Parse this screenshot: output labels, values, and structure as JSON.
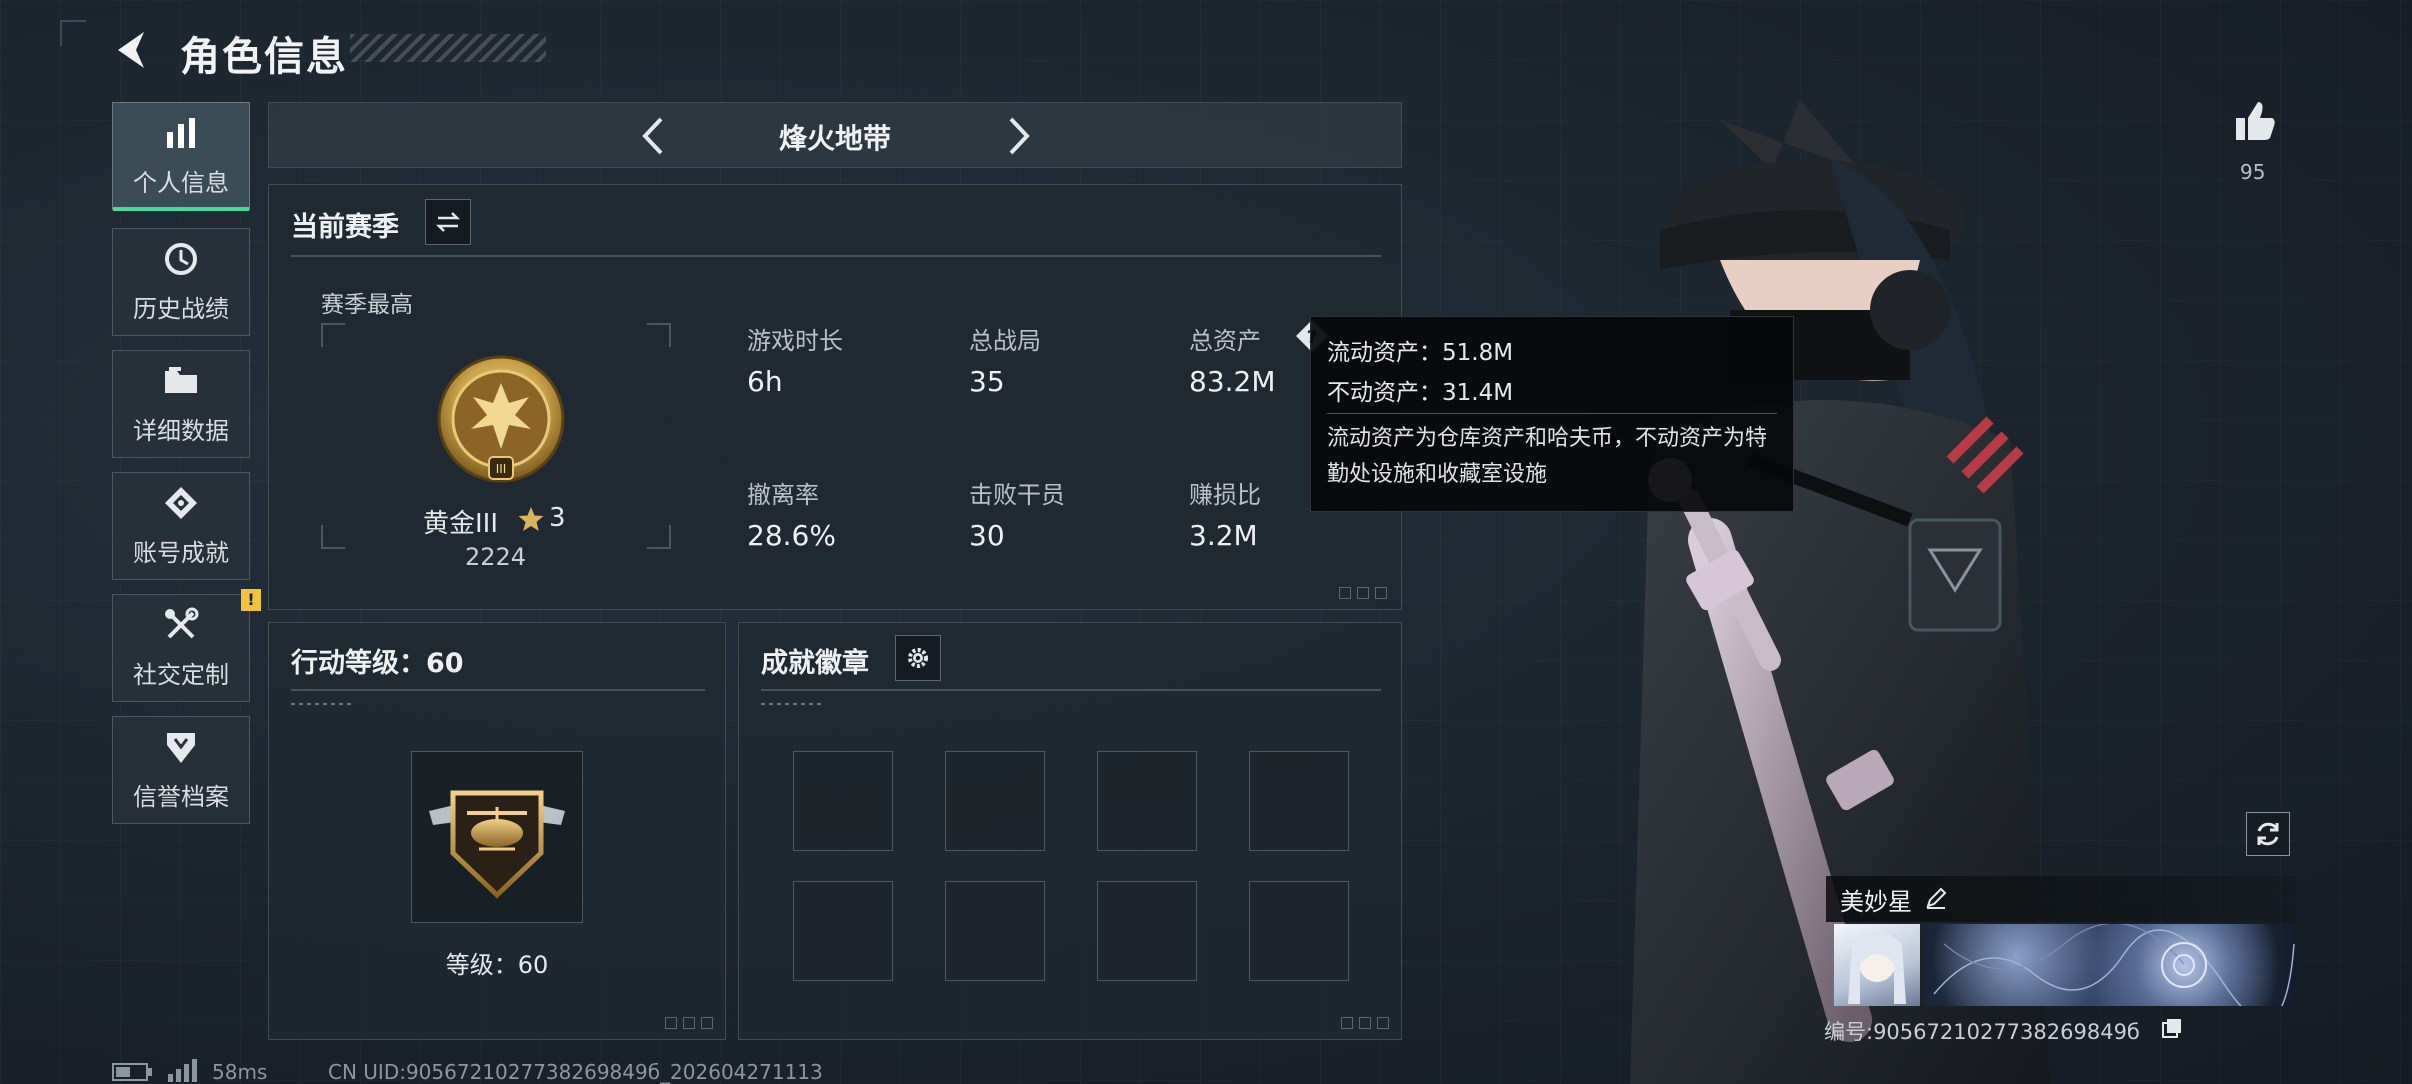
{
  "header": {
    "title": "角色信息"
  },
  "sidebar": {
    "items": [
      {
        "label": "个人信息",
        "icon": "bar-chart-icon",
        "active": true
      },
      {
        "label": "历史战绩",
        "icon": "history-clock-icon"
      },
      {
        "label": "详细数据",
        "icon": "folder-icon"
      },
      {
        "label": "账号成就",
        "icon": "achievement-icon"
      },
      {
        "label": "社交定制",
        "icon": "tools-icon",
        "badge": "!"
      },
      {
        "label": "信誉档案",
        "icon": "shield-badge-icon"
      }
    ]
  },
  "mode_selector": {
    "label": "烽火地带"
  },
  "season": {
    "title": "当前赛季",
    "best_label": "赛季最高",
    "rank_name": "黄金III",
    "rank_stars": "3",
    "rank_score": "2224",
    "stats": [
      {
        "label": "游戏时长",
        "value": "6h"
      },
      {
        "label": "总战局",
        "value": "35"
      },
      {
        "label": "总资产",
        "value": "83.2M"
      },
      {
        "label": "撤离率",
        "value": "28.6%"
      },
      {
        "label": "击败干员",
        "value": "30"
      },
      {
        "label": "赚损比",
        "value": "3.2M"
      }
    ]
  },
  "tooltip": {
    "line1": "流动资产：51.8M",
    "line2": "不动资产：31.4M",
    "description": "流动资产为仓库资产和哈夫币，不动资产为特勤处设施和收藏室设施"
  },
  "action_level": {
    "title": "行动等级：60",
    "level_label": "等级：60"
  },
  "achievements": {
    "title": "成就徽章"
  },
  "character": {
    "likes": "95",
    "name": "美妙星",
    "uid_line": "编号:9056721027738269849б"
  },
  "status_bar": {
    "ping": "58ms",
    "uid": "CN UID:9056721027738269849б_202604271113"
  },
  "colors": {
    "accent_green": "#3fdca0",
    "warning_yellow": "#f0c33c",
    "gold": "#c9a24a"
  }
}
